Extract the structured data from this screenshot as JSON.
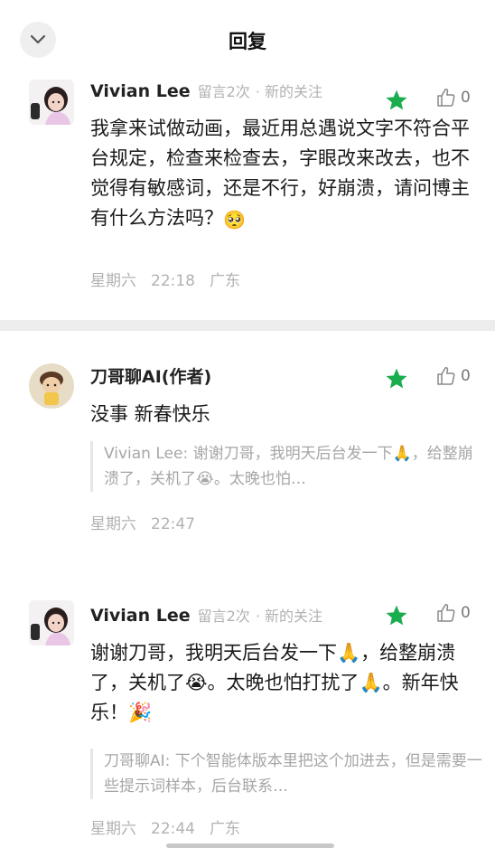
{
  "header": {
    "title": "回复",
    "back_icon": "chevron-down-icon"
  },
  "colors": {
    "star": "#1aad4e",
    "meta": "#b2b2b2",
    "quote_border": "#e6e6e6"
  },
  "comments": [
    {
      "name": "Vivian Lee",
      "badge": "留言2次",
      "follow": "· 新的关注",
      "like_count": "0",
      "text": "我拿来试做动画，最近用总遇说文字不符合平台规定，检查来检查去，字眼改来改去，也不觉得有敏感词，还是不行，好崩溃，请问博主有什么方法吗？",
      "emoji": "🥺",
      "day": "星期六",
      "time": "22:18",
      "location": "广东"
    },
    {
      "name": "刀哥聊AI(作者)",
      "like_count": "0",
      "text": "没事 新春快乐",
      "quote": "Vivian Lee: 谢谢刀哥，我明天后台发一下🙏，给整崩溃了，关机了😭。太晚也怕…",
      "day": "星期六",
      "time": "22:47"
    },
    {
      "name": "Vivian Lee",
      "badge": "留言2次",
      "follow": "· 新的关注",
      "like_count": "0",
      "text": "谢谢刀哥，我明天后台发一下🙏，给整崩溃了，关机了😭。太晚也怕打扰了🙏。新年快乐！🎉",
      "quote": "刀哥聊AI: 下个智能体版本里把这个加进去，但是需要一些提示词样本，后台联系…",
      "day": "星期六",
      "time": "22:44",
      "location": "广东"
    }
  ]
}
